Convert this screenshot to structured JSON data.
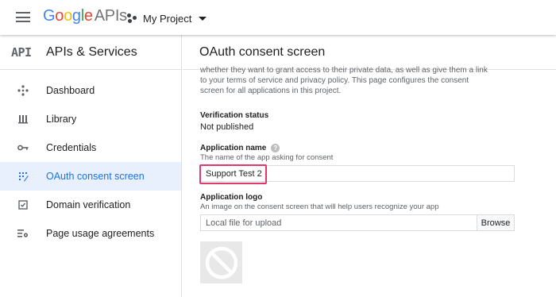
{
  "header": {
    "logo_google": [
      "G",
      "o",
      "o",
      "g",
      "l",
      "e"
    ],
    "logo_apis": "APIs",
    "project_name": "My Project"
  },
  "sidebar": {
    "api_icon_text": "API",
    "title": "APIs & Services",
    "items": [
      {
        "label": "Dashboard",
        "icon": "dashboard-icon"
      },
      {
        "label": "Library",
        "icon": "library-icon"
      },
      {
        "label": "Credentials",
        "icon": "key-icon"
      },
      {
        "label": "OAuth consent screen",
        "icon": "consent-icon",
        "active": true
      },
      {
        "label": "Domain verification",
        "icon": "checkbox-icon"
      },
      {
        "label": "Page usage agreements",
        "icon": "settings-list-icon"
      }
    ]
  },
  "main": {
    "title": "OAuth consent screen",
    "intro_line1": "whether they want to grant access to their private data, as well as give them a link",
    "intro_line2": "to your terms of service and privacy policy. This page configures the consent",
    "intro_line3": "screen for all applications in this project.",
    "verification": {
      "label": "Verification status",
      "value": "Not published"
    },
    "app_name": {
      "label": "Application name",
      "help": "?",
      "description": "The name of the app asking for consent",
      "value": "Support Test 2"
    },
    "app_logo": {
      "label": "Application logo",
      "description": "An image on the consent screen that will help users recognize your app",
      "placeholder": "Local file for upload",
      "browse_label": "Browse"
    }
  },
  "colors": {
    "accent": "#1a73e8",
    "active_bg": "#e8f0fe",
    "highlight": "#e2396c"
  }
}
